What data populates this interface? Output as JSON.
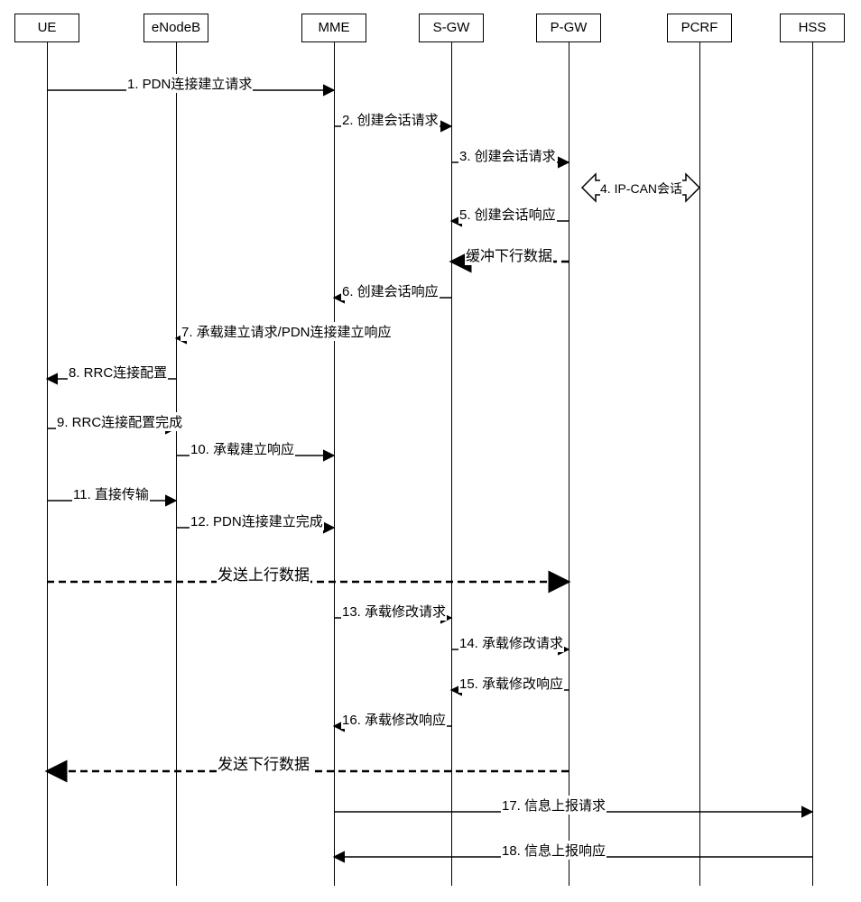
{
  "actors": {
    "ue": "UE",
    "enodeb": "eNodeB",
    "mme": "MME",
    "sgw": "S-GW",
    "pgw": "P-GW",
    "pcrf": "PCRF",
    "hss": "HSS"
  },
  "messages": {
    "m1": "1.  PDN连接建立请求",
    "m2": "2.  创建会话请求",
    "m3": "3.  创建会话请求",
    "m4": "4. IP-CAN会话",
    "m5": "5.  创建会话响应",
    "buf": "缓冲下行数据",
    "m6": "6.  创建会话响应",
    "m7": "7. 承载建立请求/PDN连接建立响应",
    "m8": "8. RRC连接配置",
    "m9": "9. RRC连接配置完成",
    "m10": "10. 承载建立响应",
    "m11": "11. 直接传输",
    "m12": "12. PDN连接建立完成",
    "ul": "发送上行数据",
    "m13": "13. 承载修改请求",
    "m14": "14. 承载修改请求",
    "m15": "15. 承载修改响应",
    "m16": "16. 承载修改响应",
    "dl": "发送下行数据",
    "m17": "17. 信息上报请求",
    "m18": "18. 信息上报响应"
  },
  "chart_data": {
    "type": "sequence-diagram",
    "actors": [
      "UE",
      "eNodeB",
      "MME",
      "S-GW",
      "P-GW",
      "PCRF",
      "HSS"
    ],
    "steps": [
      {
        "n": 1,
        "from": "UE",
        "to": "MME",
        "label": "PDN连接建立请求"
      },
      {
        "n": 2,
        "from": "MME",
        "to": "S-GW",
        "label": "创建会话请求"
      },
      {
        "n": 3,
        "from": "S-GW",
        "to": "P-GW",
        "label": "创建会话请求"
      },
      {
        "n": 4,
        "from": "P-GW",
        "to": "PCRF",
        "label": "IP-CAN会话",
        "bidirectional": true
      },
      {
        "n": 5,
        "from": "P-GW",
        "to": "S-GW",
        "label": "创建会话响应"
      },
      {
        "n": null,
        "from": "P-GW",
        "to": "S-GW",
        "label": "缓冲下行数据",
        "dashed": true
      },
      {
        "n": 6,
        "from": "S-GW",
        "to": "MME",
        "label": "创建会话响应"
      },
      {
        "n": 7,
        "from": "MME",
        "to": "eNodeB",
        "label": "承载建立请求/PDN连接建立响应"
      },
      {
        "n": 8,
        "from": "eNodeB",
        "to": "UE",
        "label": "RRC连接配置"
      },
      {
        "n": 9,
        "from": "UE",
        "to": "eNodeB",
        "label": "RRC连接配置完成"
      },
      {
        "n": 10,
        "from": "eNodeB",
        "to": "MME",
        "label": "承载建立响应"
      },
      {
        "n": 11,
        "from": "UE",
        "to": "eNodeB",
        "label": "直接传输"
      },
      {
        "n": 12,
        "from": "eNodeB",
        "to": "MME",
        "label": "PDN连接建立完成"
      },
      {
        "n": null,
        "from": "UE",
        "to": "P-GW",
        "label": "发送上行数据",
        "dashed": true
      },
      {
        "n": 13,
        "from": "MME",
        "to": "S-GW",
        "label": "承载修改请求"
      },
      {
        "n": 14,
        "from": "S-GW",
        "to": "P-GW",
        "label": "承载修改请求"
      },
      {
        "n": 15,
        "from": "P-GW",
        "to": "S-GW",
        "label": "承载修改响应"
      },
      {
        "n": 16,
        "from": "S-GW",
        "to": "MME",
        "label": "承载修改响应"
      },
      {
        "n": null,
        "from": "P-GW",
        "to": "UE",
        "label": "发送下行数据",
        "dashed": true
      },
      {
        "n": 17,
        "from": "MME",
        "to": "HSS",
        "label": "信息上报请求"
      },
      {
        "n": 18,
        "from": "HSS",
        "to": "MME",
        "label": "信息上报响应"
      }
    ]
  }
}
